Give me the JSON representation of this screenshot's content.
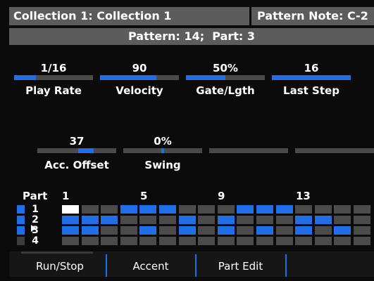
{
  "header": {
    "collection": "Collection 1: Collection 1",
    "pattern_note": "Pattern Note: C-2",
    "pattern": "Pattern: 14;  Part: 3"
  },
  "params_row1": [
    {
      "value": "1/16",
      "label": "Play Rate",
      "level": 0.28
    },
    {
      "value": "90",
      "label": "Velocity",
      "level": 0.71
    },
    {
      "value": "50%",
      "label": "Gate/Lgth",
      "level": 0.5
    },
    {
      "value": "16",
      "label": "Last Step",
      "level": 1.0
    }
  ],
  "params_row2": [
    {
      "value": "37",
      "label": "Acc. Offset",
      "marker": 0.62
    },
    {
      "value": "0%",
      "label": "Swing",
      "marker": 0.5
    },
    {
      "value": "",
      "label": ""
    },
    {
      "value": "",
      "label": ""
    }
  ],
  "grid": {
    "part_label": "Part",
    "step_labels": [
      "1",
      "5",
      "9",
      "13"
    ],
    "rows": [
      {
        "number": "1",
        "steps": [
          2,
          0,
          0,
          1,
          1,
          1,
          0,
          0,
          0,
          1,
          1,
          1,
          0,
          0,
          0,
          0
        ]
      },
      {
        "number": "2",
        "steps": [
          1,
          1,
          1,
          0,
          0,
          0,
          1,
          0,
          1,
          0,
          0,
          0,
          1,
          1,
          0,
          0
        ]
      },
      {
        "number": "3",
        "steps": [
          1,
          1,
          0,
          0,
          1,
          0,
          1,
          0,
          1,
          0,
          1,
          0,
          1,
          0,
          1,
          0
        ]
      },
      {
        "number": "4",
        "steps": [
          0,
          0,
          0,
          0,
          0,
          0,
          0,
          0,
          0,
          0,
          0,
          0,
          0,
          0,
          0,
          0
        ]
      }
    ],
    "selected_row": 3
  },
  "buttons": [
    "Run/Stop",
    "Accent",
    "Part Edit"
  ],
  "colors": {
    "accent": "#1f6fe8",
    "panel": "#5c5c5c",
    "cell_off": "#4b4b4b"
  }
}
